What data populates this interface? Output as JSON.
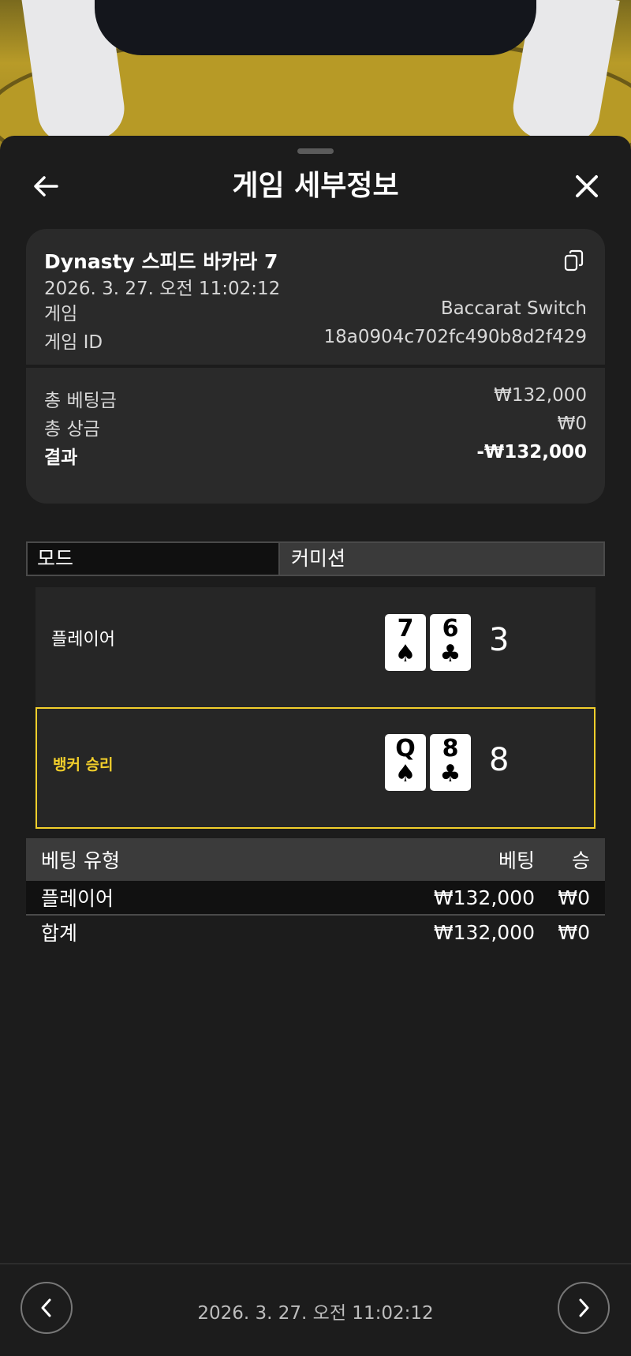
{
  "header": {
    "title": "게임 세부정보"
  },
  "summary": {
    "game_name": "Dynasty 스피드 바카라 7",
    "datetime": "2026. 3. 27. 오전 11:02:12",
    "game_label": "게임",
    "game_value": "Baccarat Switch",
    "game_id_label": "게임 ID",
    "game_id_value": "18a0904c702fc490b8d2f429",
    "total_bet_label": "총 베팅금",
    "total_bet_value": "₩132,000",
    "total_prize_label": "총 상금",
    "total_prize_value": "₩0",
    "result_label": "결과",
    "result_value": "-₩132,000"
  },
  "mode": {
    "label": "모드",
    "value": "커미션"
  },
  "hands": {
    "player": {
      "label": "플레이어",
      "cards": [
        {
          "rank": "7",
          "suit": "♠"
        },
        {
          "rank": "6",
          "suit": "♣"
        }
      ],
      "score": "3"
    },
    "banker": {
      "label": "뱅커 승리",
      "cards": [
        {
          "rank": "Q",
          "suit": "♠"
        },
        {
          "rank": "8",
          "suit": "♣"
        }
      ],
      "score": "8"
    }
  },
  "bets": {
    "headers": {
      "type": "베팅 유형",
      "bet": "베팅",
      "win": "승"
    },
    "rows": [
      {
        "type": "플레이어",
        "bet": "₩132,000",
        "win": "₩0"
      }
    ],
    "total": {
      "type": "합계",
      "bet": "₩132,000",
      "win": "₩0"
    }
  },
  "footer": {
    "datetime": "2026. 3. 27. 오전 11:02:12"
  },
  "colors": {
    "accent": "#f2cf2b",
    "sheet_bg": "#1c1c1c",
    "card_bg": "#2a2a2a"
  },
  "icons": {
    "back": "arrow-left-icon",
    "close": "close-icon",
    "copy": "copy-icon",
    "prev": "chevron-left-icon",
    "next": "chevron-right-icon"
  }
}
